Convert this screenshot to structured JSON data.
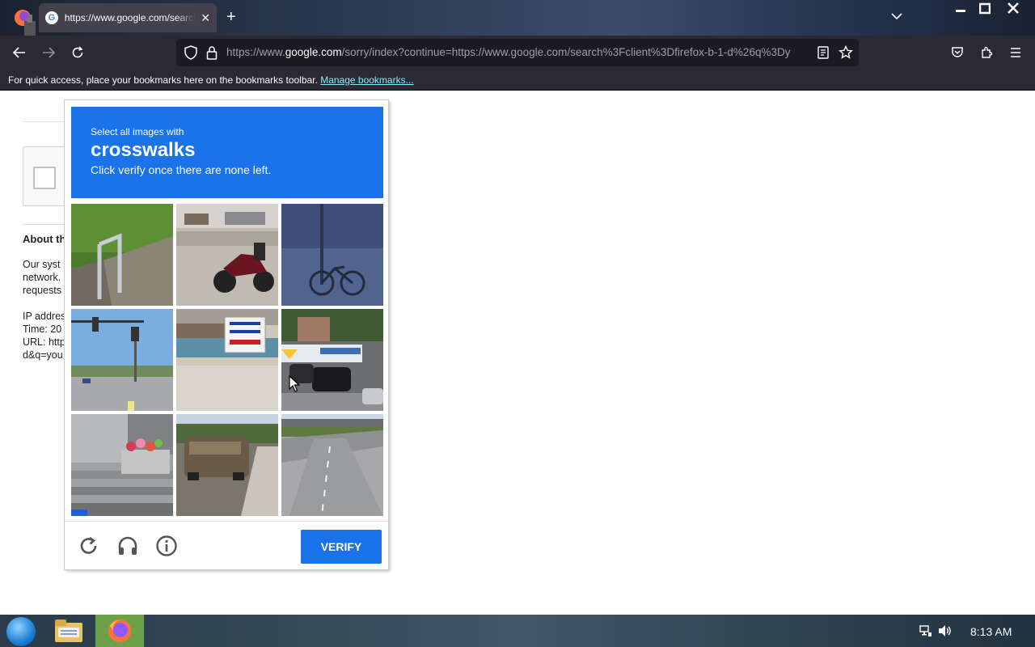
{
  "browser": {
    "tab_title": "https://www.google.com/search",
    "url_prefix": "https://www.",
    "url_host": "google.com",
    "url_rest": "/sorry/index?continue=https://www.google.com/search%3Fclient%3Dfirefox-b-1-d%26q%3Dy",
    "bookmarks_text": "For quick access, place your bookmarks here on the bookmarks toolbar.",
    "bookmarks_link": "Manage bookmarks..."
  },
  "page": {
    "about_title": "About th",
    "about_lines": [
      "Our syst",
      "network.",
      "requests",
      "IP addres",
      "Time: 20",
      "URL: http",
      "d&q=you"
    ]
  },
  "captcha": {
    "instruction": "Select all images with",
    "target": "crosswalks",
    "hint": "Click verify once there are none left.",
    "verify_label": "VERIFY",
    "tiles": [
      "railing-by-hedge",
      "motorcycle",
      "bicycle-on-sidewalk",
      "traffic-light-intersection",
      "japanese-signboard",
      "bus-and-cars",
      "steps-with-flowers",
      "truck-on-road",
      "highway-overpass"
    ]
  },
  "taskbar": {
    "clock": "8:13 AM"
  },
  "colors": {
    "captcha_blue": "#1a73e8",
    "chrome_dark": "#2b2a33",
    "link": "#80ebff"
  }
}
